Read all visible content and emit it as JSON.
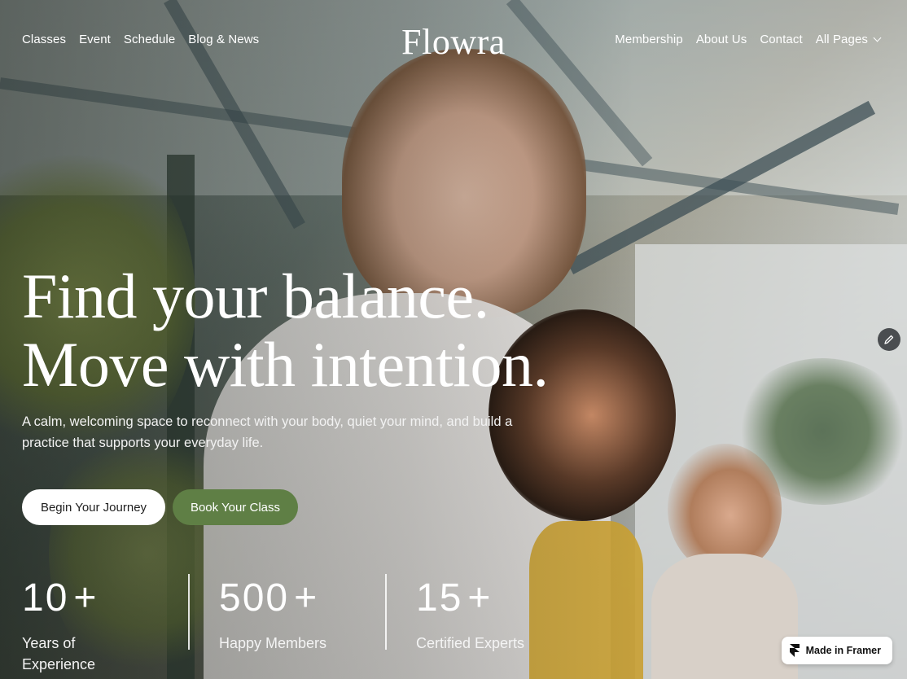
{
  "brand": {
    "logo": "Flowra"
  },
  "nav": {
    "left": [
      "Classes",
      "Event",
      "Schedule",
      "Blog & News"
    ],
    "right": [
      "Membership",
      "About Us",
      "Contact",
      "All Pages"
    ]
  },
  "hero": {
    "headline_line1": "Find your balance.",
    "headline_line2": "Move with intention.",
    "subtitle": "A calm, welcoming space to reconnect with your body, quiet your mind, and build a practice that supports your everyday life.",
    "primary_cta": "Begin Your Journey",
    "secondary_cta": "Book Your Class"
  },
  "stats": [
    {
      "value": "10",
      "suffix": "+",
      "label": "Years of Experience"
    },
    {
      "value": "500",
      "suffix": "+",
      "label": "Happy Members"
    },
    {
      "value": "15",
      "suffix": "+",
      "label": "Certified Experts"
    }
  ],
  "badge": {
    "label": "Made in Framer"
  },
  "icons": {
    "dropdown": "chevron-down-icon",
    "edit": "pencil-icon",
    "framer": "framer-logo-icon"
  },
  "colors": {
    "secondary_button": "#5f7f45",
    "primary_button": "#ffffff"
  }
}
